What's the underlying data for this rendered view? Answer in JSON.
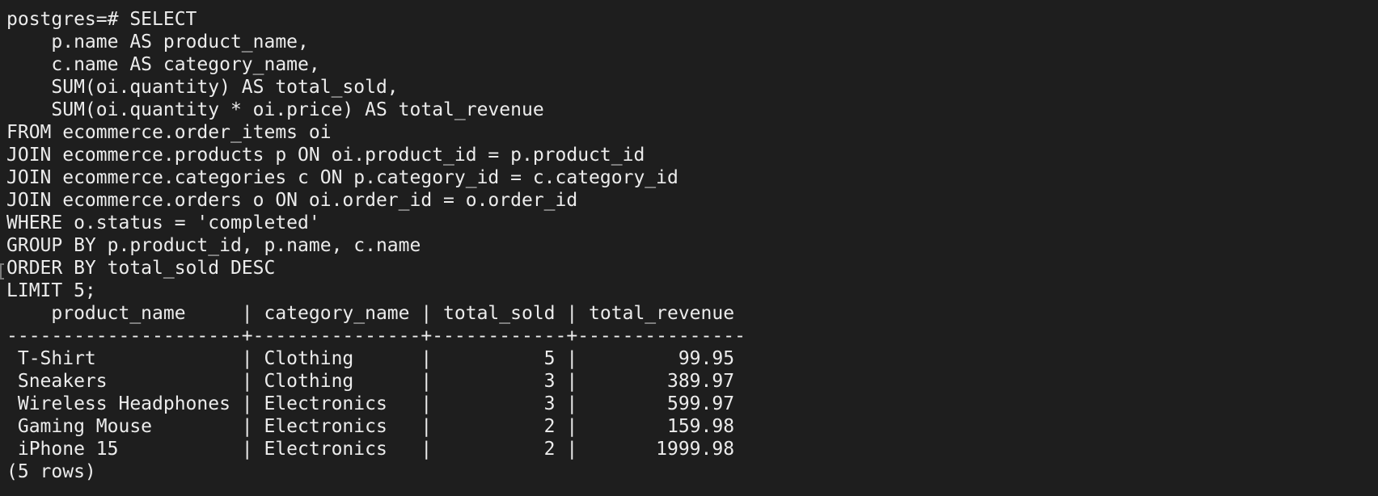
{
  "terminal": {
    "background": "#1e1e1e",
    "foreground": "#ececec",
    "lines": [
      "postgres=# SELECT",
      "    p.name AS product_name,",
      "    c.name AS category_name,",
      "    SUM(oi.quantity) AS total_sold,",
      "    SUM(oi.quantity * oi.price) AS total_revenue",
      "FROM ecommerce.order_items oi",
      "JOIN ecommerce.products p ON oi.product_id = p.product_id",
      "JOIN ecommerce.categories c ON p.category_id = c.category_id",
      "JOIN ecommerce.orders o ON oi.order_id = o.order_id",
      "WHERE o.status = 'completed'",
      "GROUP BY p.product_id, p.name, c.name",
      "ORDER BY total_sold DESC",
      "LIMIT 5;",
      "    product_name     | category_name | total_sold | total_revenue",
      "---------------------+---------------+------------+---------------",
      " T-Shirt             | Clothing      |          5 |         99.95",
      " Sneakers            | Clothing      |          3 |        389.97",
      " Wireless Headphones | Electronics   |          3 |        599.97",
      " Gaming Mouse        | Electronics   |          2 |        159.98",
      " iPhone 15           | Electronics   |          2 |       1999.98",
      "(5 rows)"
    ]
  }
}
